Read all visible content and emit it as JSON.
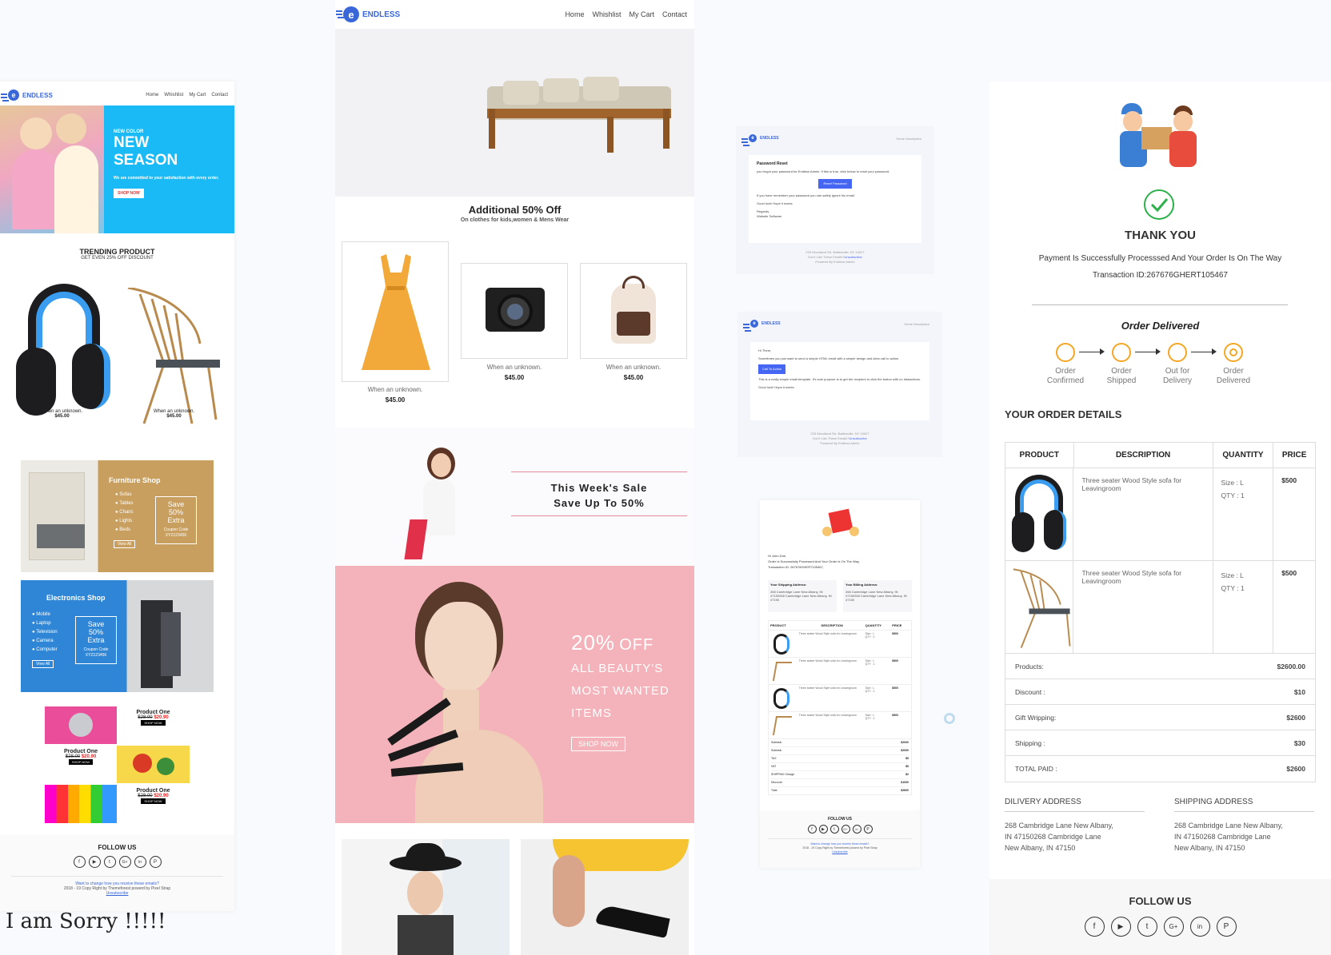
{
  "brand": "ENDLESS",
  "nav": [
    "Home",
    "Whishlist",
    "My Cart",
    "Contact"
  ],
  "sorry_text": "I am Sorry !!!!!",
  "email1": {
    "hero": {
      "kicker": "NEW COLOR",
      "title_line1": "NEW",
      "title_line2": "SEASON",
      "subtitle": "We are committed to your satisfaction with every order.",
      "cta": "SHOP NOW"
    },
    "trending": {
      "title": "TRENDING PRODUCT",
      "subtitle": "GET EVEN 25% OFF DISCOUNT"
    },
    "products": [
      {
        "name": "When an unknown.",
        "price": "$45.00"
      },
      {
        "name": "When an unknown.",
        "price": "$45.00"
      }
    ],
    "furniture": {
      "title": "Furniture Shop",
      "items": [
        "Sofas",
        "Tables",
        "Chairs",
        "Lights",
        "Beds"
      ],
      "save": "Save",
      "pct": "50%",
      "extra": "Extra",
      "coupon_label": "Coupon Code",
      "coupon": "XYZ123456",
      "cta": "View All"
    },
    "electronics": {
      "title": "Electronics Shop",
      "items": [
        "Mobile",
        "Laptop",
        "Television",
        "Camera",
        "Computer"
      ],
      "save": "Save",
      "pct": "50%",
      "extra": "Extra",
      "coupon_label": "Coupon Code",
      "coupon": "XYZ123456",
      "cta": "View All"
    },
    "mini_products": [
      {
        "name": "Product One",
        "old": "$28.00",
        "new": "$20.90",
        "cta": "SHOP NOW"
      },
      {
        "name": "Product One",
        "old": "$28.00",
        "new": "$20.90",
        "cta": "SHOP NOW"
      },
      {
        "name": "Product One",
        "old": "$28.00",
        "new": "$20.90",
        "cta": "SHOP NOW"
      }
    ],
    "follow": "FOLLOW US",
    "footer_link": "Want to change how you receive these emails?",
    "footer_copy": "2018 - 19 Copy Right by Themeforest powerd by Pixel Strap",
    "unsubscribe": "Unsubscribe"
  },
  "email2": {
    "promo_title": "Additional 50% Off",
    "promo_sub": "On clothes for kids,women & Mens Wear",
    "products": [
      {
        "name": "When an unknown.",
        "price": "$45.00"
      },
      {
        "name": "When an unknown.",
        "price": "$45.00"
      },
      {
        "name": "When an unknown.",
        "price": "$45.00"
      }
    ],
    "sale_line1": "This Week's Sale",
    "sale_line2": "Save Up To 50%",
    "beauty_pct": "20%",
    "beauty_off": "OFF",
    "beauty_line1": "ALL BEAUTY'S",
    "beauty_line2": "MOST WANTED",
    "beauty_line3": "ITEMS",
    "beauty_cta": "SHOP NOW"
  },
  "email3": {
    "desc": "Some Description",
    "title": "Password Reset",
    "body1": "you forgot your password for Endless Admin. If this is true, click below to reset your password.",
    "cta": "Reset Password",
    "body2": "If you have remember your password you can safely ignore his email.",
    "luck": "Good luck! Hope it works.",
    "regards": "Regards,",
    "sign": "Website Software",
    "addr": "233 Woodland Rd. Battlesville, NY 10027",
    "dislike": "Don't Like These Emails?",
    "unsubscribe": "Unsubscribe",
    "powered": "Powered By Endless Admin"
  },
  "email4": {
    "desc": "Some Description",
    "hi": "Hi There,",
    "body1": "Sometimes you just want to send a simple HTML email with a simple design and clear call to action.",
    "cta": "Call To Action",
    "body2": "This is a really simple email template. It's sole purpose is to get the recipient to click the button with no distractions.",
    "luck": "Good luck! Hope it works.",
    "addr": "233 Woodland Rd. Battlesville, NY 10027",
    "dislike": "Don't Like These Emails?",
    "unsubscribe": "Unsubscribe",
    "powered": "Powered By Endless Admin"
  },
  "email5": {
    "hi": "Hi John Doe,",
    "line1": "Order Is Successfully Processed And Your Order Is On The Way,",
    "line2": "Transaction ID: 267676GHERT105467,",
    "ship_title": "Your Shipping Address:",
    "bill_title": "Your Billing Address:",
    "address": "268 Cambridge Lane New Albany, IN 47150268 Cambridge Lane New Albany, IN 47150",
    "headers": [
      "PRODUCT",
      "DESCRIPTION",
      "QUANTITY",
      "PRICE"
    ],
    "rows": [
      {
        "desc": "Three seater Wood Style sofa for Leavingroom",
        "size": "Size : L",
        "qty": "QTY : 1",
        "price": "$500"
      },
      {
        "desc": "Three seater Wood Style sofa for Leavingroom",
        "size": "Size : L",
        "qty": "QTY : 1",
        "price": "$500"
      },
      {
        "desc": "Three seater Wood Style sofa for Leavingroom",
        "size": "Size : L",
        "qty": "QTY : 1",
        "price": "$500"
      },
      {
        "desc": "Three seater Wood Style sofa for Leavingroom",
        "size": "Size : L",
        "qty": "QTY : 1",
        "price": "$500"
      }
    ],
    "totals": [
      {
        "label": "Subtotal",
        "value": "$2000"
      },
      {
        "label": "Subtotal",
        "value": "$2000"
      },
      {
        "label": "TAX",
        "value": "$5"
      },
      {
        "label": "VAT",
        "value": "$5"
      },
      {
        "label": "SHIPPING Charge",
        "value": "$2"
      },
      {
        "label": "Discount",
        "value": "$1000"
      },
      {
        "label": "Total",
        "value": "$2600"
      }
    ],
    "follow": "FOLLOW US",
    "footer_link": "Want to change how you receive these emails?",
    "footer_copy": "2018 - 19 Copy Right by Themeforest powerd by Pixel Strap",
    "unsubscribe": "Unsubscribe"
  },
  "email6": {
    "thank": "THANK YOU",
    "message": "Payment Is Successfully Processsed And Your Order Is On The Way",
    "transaction": "Transaction ID:267676GHERT105467",
    "status_title": "Order Delivered",
    "steps": [
      {
        "l1": "Order",
        "l2": "Confirmed"
      },
      {
        "l1": "Order",
        "l2": "Shipped"
      },
      {
        "l1": "Out for",
        "l2": "Delivery"
      },
      {
        "l1": "Order",
        "l2": "Delivered"
      }
    ],
    "details_title": "YOUR ORDER DETAILS",
    "headers": [
      "PRODUCT",
      "DESCRIPTION",
      "QUANTITY",
      "PRICE"
    ],
    "rows": [
      {
        "desc": "Three seater Wood Style sofa for Leavingroom",
        "size": "Size : L",
        "qty": "QTY : 1",
        "price": "$500"
      },
      {
        "desc": "Three seater Wood Style sofa for Leavingroom",
        "size": "Size : L",
        "qty": "QTY : 1",
        "price": "$500"
      }
    ],
    "totals": [
      {
        "label": "Products:",
        "value": "$2600.00"
      },
      {
        "label": "Discount :",
        "value": "$10"
      },
      {
        "label": "Gift Wripping:",
        "value": "$2600"
      },
      {
        "label": "Shipping :",
        "value": "$30"
      },
      {
        "label": "TOTAL PAID :",
        "value": "$2600"
      }
    ],
    "delivery_title": "DILIVERY ADDRESS",
    "shipping_title": "SHIPPING ADDRESS",
    "addr1": "268 Cambridge Lane New Albany,",
    "addr2": "IN 47150268 Cambridge Lane",
    "addr3": "New Albany, IN 47150",
    "follow": "FOLLOW US"
  },
  "social_icons": [
    "f",
    "▶",
    "t",
    "G+",
    "in",
    "P"
  ]
}
